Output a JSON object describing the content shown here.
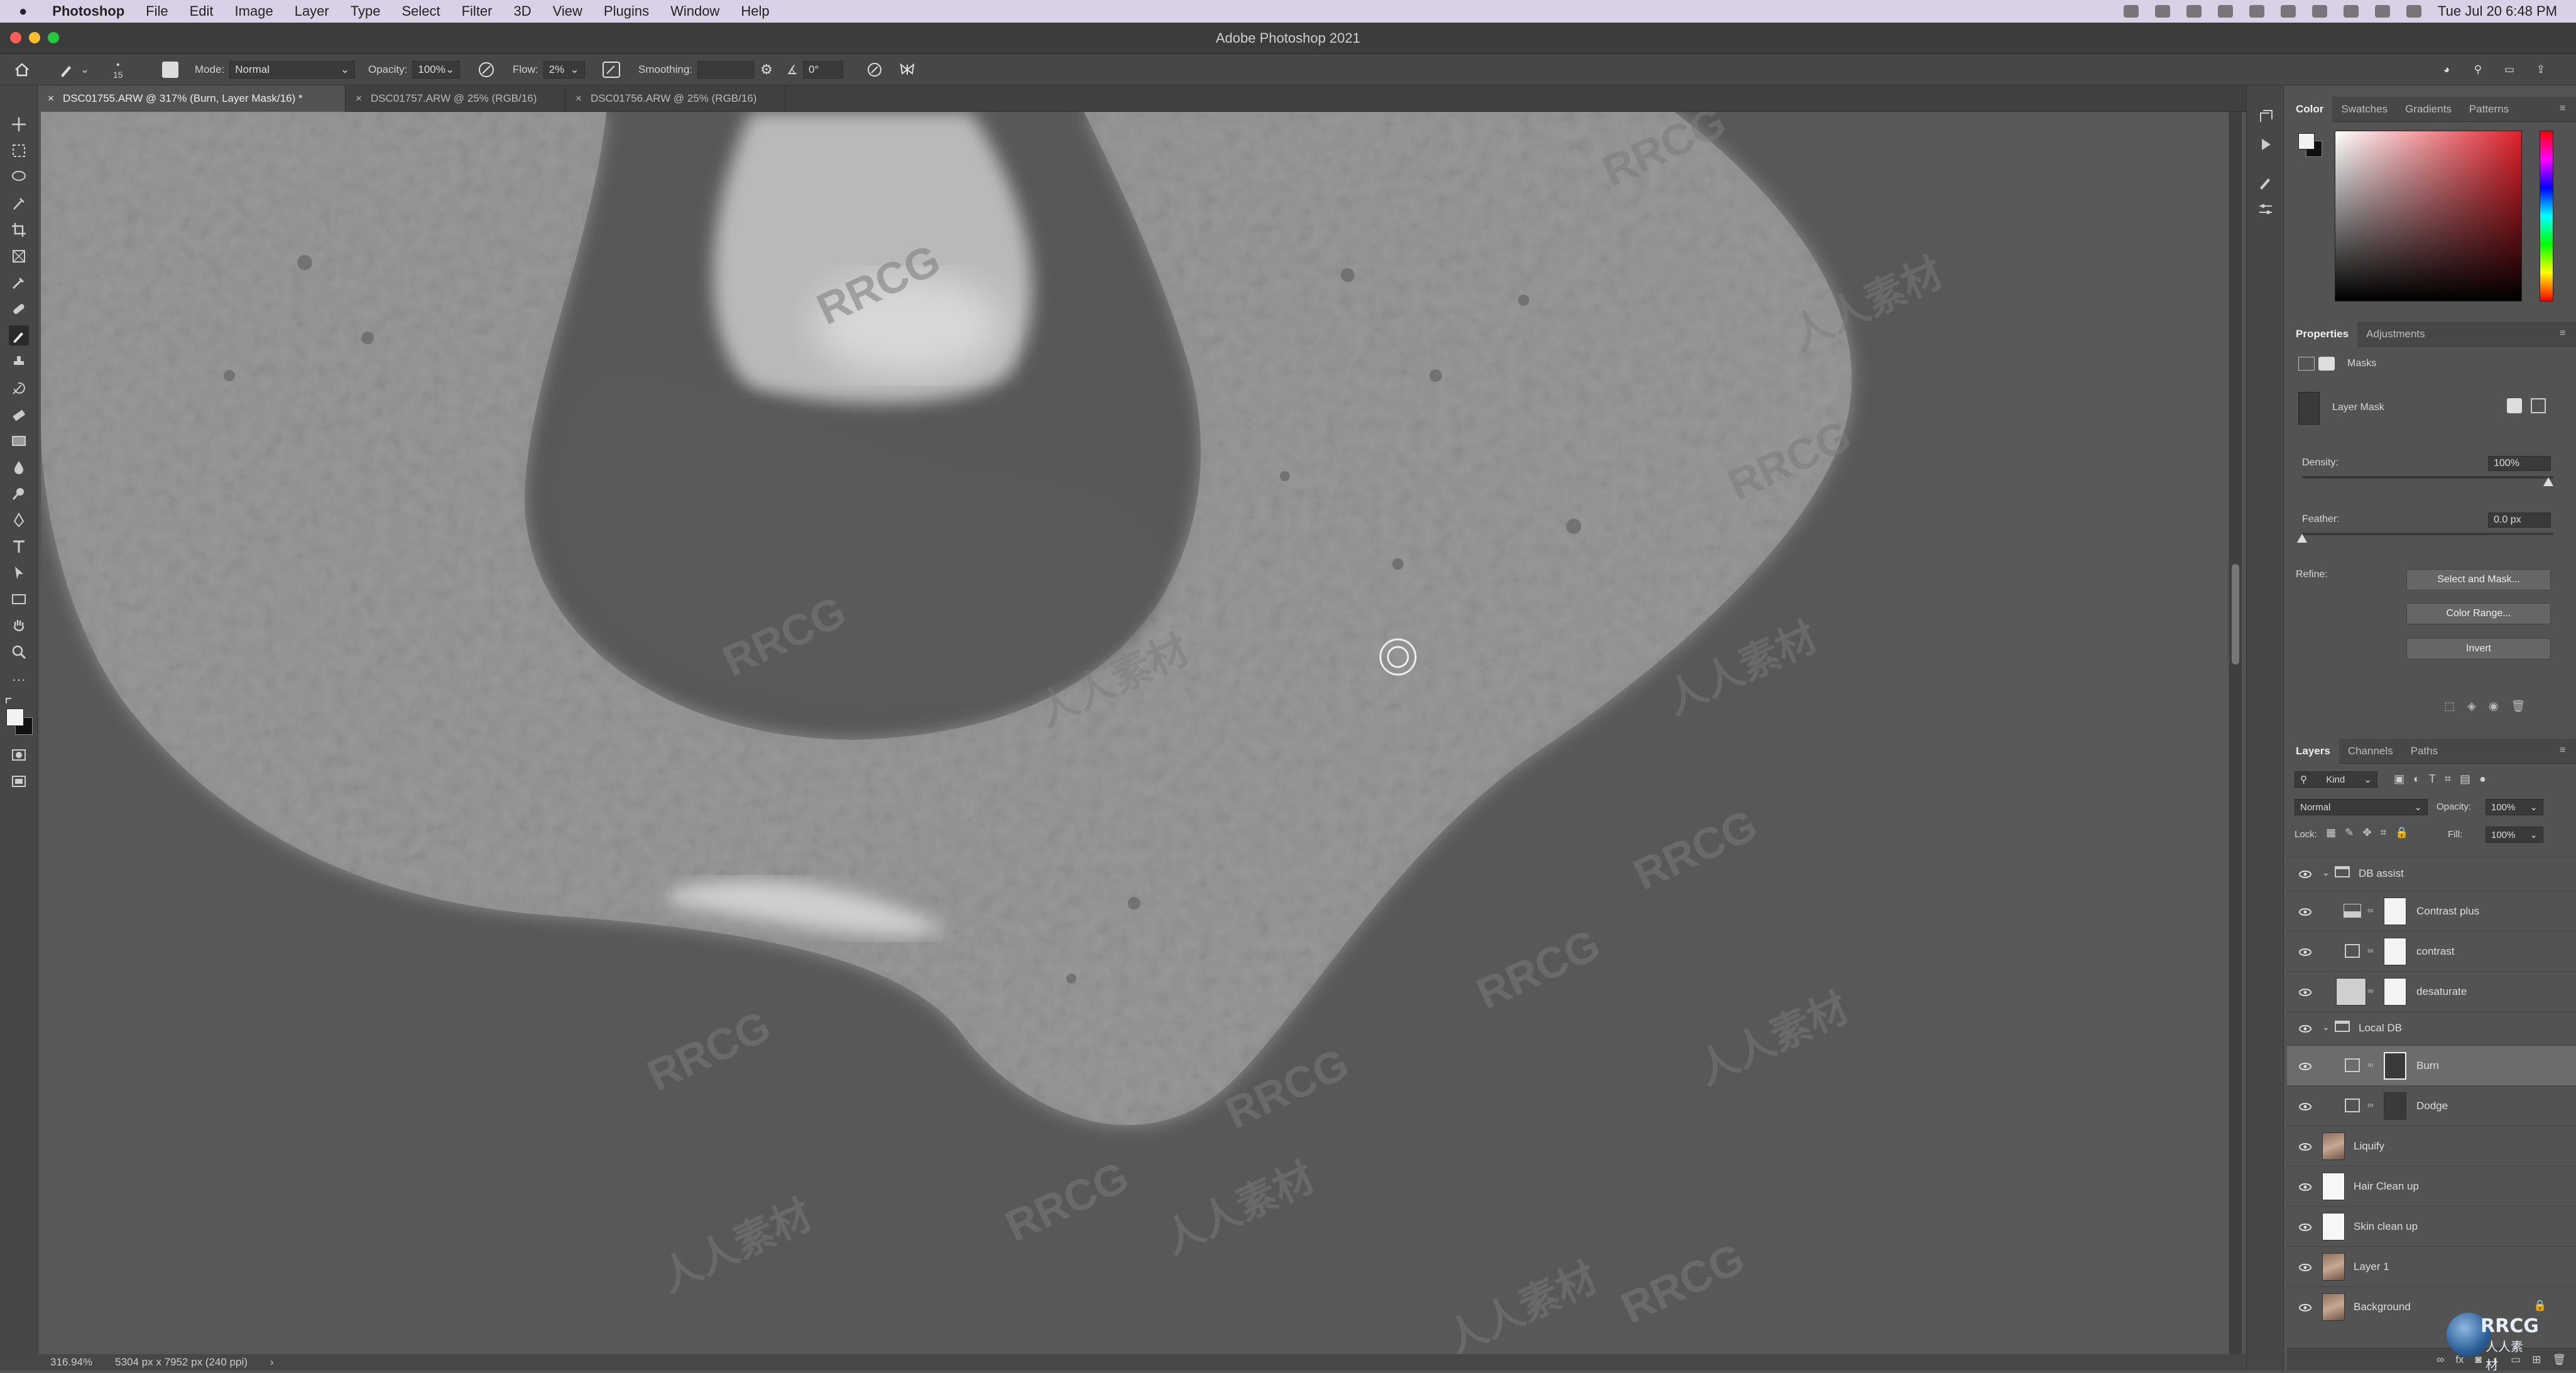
{
  "menubar": {
    "apple": "",
    "app": "Photoshop",
    "items": [
      "File",
      "Edit",
      "Image",
      "Layer",
      "Type",
      "Select",
      "Filter",
      "3D",
      "View",
      "Plugins",
      "Window",
      "Help"
    ],
    "clock": "Tue Jul 20  6:48 PM"
  },
  "window": {
    "title": "Adobe Photoshop 2021"
  },
  "options": {
    "brush_size": "15",
    "mode_label": "Mode:",
    "mode_value": "Normal",
    "opacity_label": "Opacity:",
    "opacity_value": "100%",
    "flow_label": "Flow:",
    "flow_value": "2%",
    "smoothing_label": "Smoothing:",
    "smoothing_value": "",
    "angle_value": "0°"
  },
  "tabs": [
    {
      "label": "DSC01755.ARW @ 317% (Burn, Layer Mask/16) *"
    },
    {
      "label": "DSC01757.ARW @ 25% (RGB/16)"
    },
    {
      "label": "DSC01756.ARW @ 25% (RGB/16)"
    }
  ],
  "status": {
    "zoom": "316.94%",
    "doc": "5304 px x 7952 px (240 ppi)"
  },
  "watermarks": {
    "latin": "RRCG",
    "cjk": "人人素材"
  },
  "color_panel": {
    "tabs": [
      "Color",
      "Swatches",
      "Gradients",
      "Patterns"
    ],
    "active": "Color",
    "hue_color": "#e0202a"
  },
  "properties": {
    "tabs": [
      "Properties",
      "Adjustments"
    ],
    "section": "Masks",
    "mask_name": "Layer Mask",
    "density_label": "Density:",
    "density_value": "100%",
    "density_level": 1.0,
    "feather_label": "Feather:",
    "feather_value": "0.0 px",
    "feather_level": 0.0,
    "refine_label": "Refine:",
    "buttons": [
      "Select and Mask...",
      "Color Range...",
      "Invert"
    ]
  },
  "layers_panel": {
    "tabs": [
      "Layers",
      "Channels",
      "Paths"
    ],
    "kind": "Kind",
    "blend": "Normal",
    "opacity_label": "Opacity:",
    "opacity_value": "100%",
    "lock_label": "Lock:",
    "fill_label": "Fill:",
    "fill_value": "100%",
    "layers": [
      {
        "name": "DB assist",
        "type": "group"
      },
      {
        "name": "Contrast plus",
        "type": "adjustment"
      },
      {
        "name": "contrast",
        "type": "adjustment"
      },
      {
        "name": "desaturate",
        "type": "adjustment"
      },
      {
        "name": "Local DB",
        "type": "group"
      },
      {
        "name": "Burn",
        "type": "adjustment",
        "selected": true
      },
      {
        "name": "Dodge",
        "type": "adjustment"
      },
      {
        "name": "Liquify",
        "type": "image"
      },
      {
        "name": "Hair Clean up",
        "type": "blank"
      },
      {
        "name": "Skin clean up",
        "type": "blank"
      },
      {
        "name": "Layer 1",
        "type": "image"
      },
      {
        "name": "Background",
        "type": "image"
      }
    ]
  },
  "logo": {
    "text": "RRCG",
    "sub": "人人素材"
  }
}
